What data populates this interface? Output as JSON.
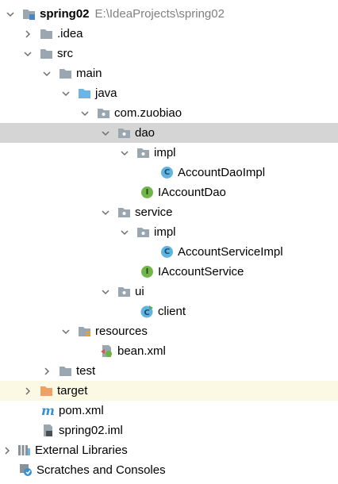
{
  "project": {
    "name": "spring02",
    "path": "E:\\IdeaProjects\\spring02"
  },
  "nodes": {
    "idea": ".idea",
    "src": "src",
    "main": "main",
    "java": "java",
    "pkg": "com.zuobiao",
    "dao": "dao",
    "dao_impl": "impl",
    "account_dao_impl": "AccountDaoImpl",
    "iaccount_dao": "IAccountDao",
    "service": "service",
    "service_impl": "impl",
    "account_service_impl": "AccountServiceImpl",
    "iaccount_service": "IAccountService",
    "ui": "ui",
    "client": "client",
    "resources": "resources",
    "bean_xml": "bean.xml",
    "test": "test",
    "target": "target",
    "pom": "pom.xml",
    "iml": "spring02.iml",
    "ext_libs": "External Libraries",
    "scratches": "Scratches and Consoles"
  },
  "icon_letters": {
    "class": "C",
    "interface": "I"
  },
  "colors": {
    "selection": "#d5d5d5",
    "excluded_bg": "#fbf9e4",
    "folder": "#9aa7b0",
    "source_folder": "#6cb4e4",
    "excluded_folder": "#f0a064",
    "class_icon": "#5fb4e0",
    "interface_icon": "#72b54a"
  }
}
